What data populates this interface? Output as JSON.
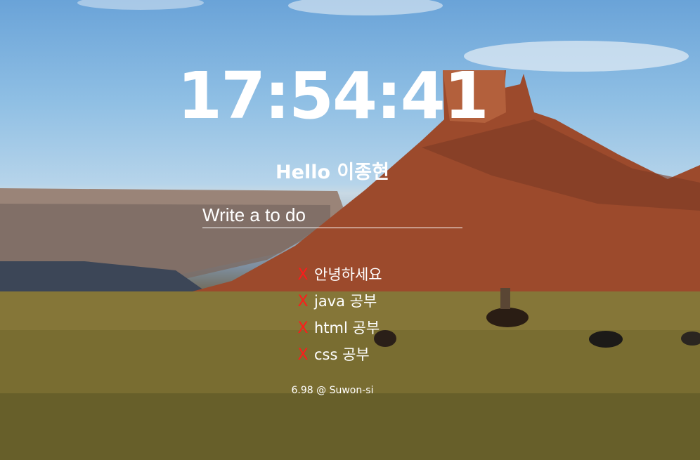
{
  "clock": {
    "time": "17:54:41"
  },
  "greeting": {
    "text": "Hello 이종현"
  },
  "todo_form": {
    "placeholder": "Write a to do"
  },
  "todos": [
    {
      "delete_label": "X",
      "text": "안녕하세요"
    },
    {
      "delete_label": "X",
      "text": "java 공부"
    },
    {
      "delete_label": "X",
      "text": "html 공부"
    },
    {
      "delete_label": "X",
      "text": "css 공부"
    }
  ],
  "weather": {
    "text": "6.98 @ Suwon-si"
  },
  "colors": {
    "delete": "#ff1a1a",
    "text": "#ffffff"
  }
}
